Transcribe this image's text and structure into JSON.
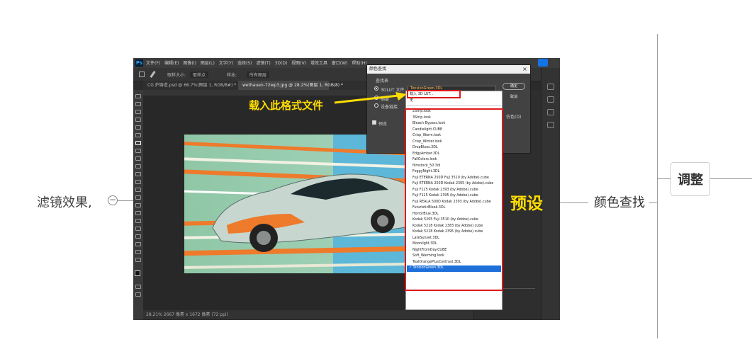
{
  "mindmap": {
    "left_label": "滤镜效果,",
    "collapse_symbol": "−",
    "node_label": "颜色查找",
    "topic": "调整"
  },
  "photoshop": {
    "logo": "Ps",
    "menu": "文件(F) 编辑(E) 图像(I) 图层(L) 文字(Y) 选择(S) 滤镜(T) 3D(D) 视图(V) 增效工具 窗口(W) 帮助(H)",
    "options": [
      "取样大小:",
      "取样点",
      "样本:",
      "所有图层"
    ],
    "tabs": [
      {
        "label": "CG 炉铸造.psd @ 66.7%(图层 1, RGB/8#) *",
        "active": false
      },
      {
        "label": "wethauen-72wp3.jpg @ 28.2%(图层 1, RGB/8) *",
        "active": true
      }
    ],
    "status": "28.21%   2667 像素 x 1672 像素 (72 ppi)"
  },
  "dialog": {
    "title": "颜色查找",
    "close": "×",
    "group_label": "查找表",
    "option_3dlut": "3DLUT 文件",
    "option_abstract": "摘要",
    "option_devicelink": "设备链接",
    "selected_file": "TensionGreen.3DL",
    "ok": "确定",
    "cancel": "取消",
    "preview": "预览",
    "dither": "仿色(D)"
  },
  "dropdown": {
    "load": "载入 3D LUT...",
    "none": "无",
    "items": [
      "2Strip.look",
      "3Strip.look",
      "Bleach Bypass.look",
      "Candlelight.CUBE",
      "Crisp_Warm.look",
      "Crisp_Winter.look",
      "DropBlues.3DL",
      "EdgyAmber.3DL",
      "FallColors.look",
      "filmstock_50.3dl",
      "FoggyNight.3DL",
      "Fuji ETERNA 250D Fuji 3510 (by Adobe).cube",
      "Fuji ETERNA 250D Kodak 2395 (by Adobe).cube",
      "Fuji F125 Kodak 2393 (by Adobe).cube",
      "Fuji F125 Kodak 2395 (by Adobe).cube",
      "Fuji REALA 500D Kodak 2393 (by Adobe).cube",
      "FuturisticBleak.3DL",
      "HorrorBlue.3DL",
      "Kodak 5205 Fuji 3510 (by Adobe).cube",
      "Kodak 5218 Kodak 2383 (by Adobe).cube",
      "Kodak 5218 Kodak 2395 (by Adobe).cube",
      "LateSunset.3DL",
      "Moonlight.3DL",
      "NightFromDay.CUBE",
      "Soft_Warming.look",
      "TealOrangePlusContrast.3DL"
    ],
    "selected": "✓ TensionGreen.3DL"
  },
  "annotations": {
    "load_format": "载入此格式文件",
    "preset": "预设"
  },
  "colors": {
    "annotation": "#ffdd00",
    "highlight_box": "#e01818",
    "selection": "#1e6fd9"
  }
}
